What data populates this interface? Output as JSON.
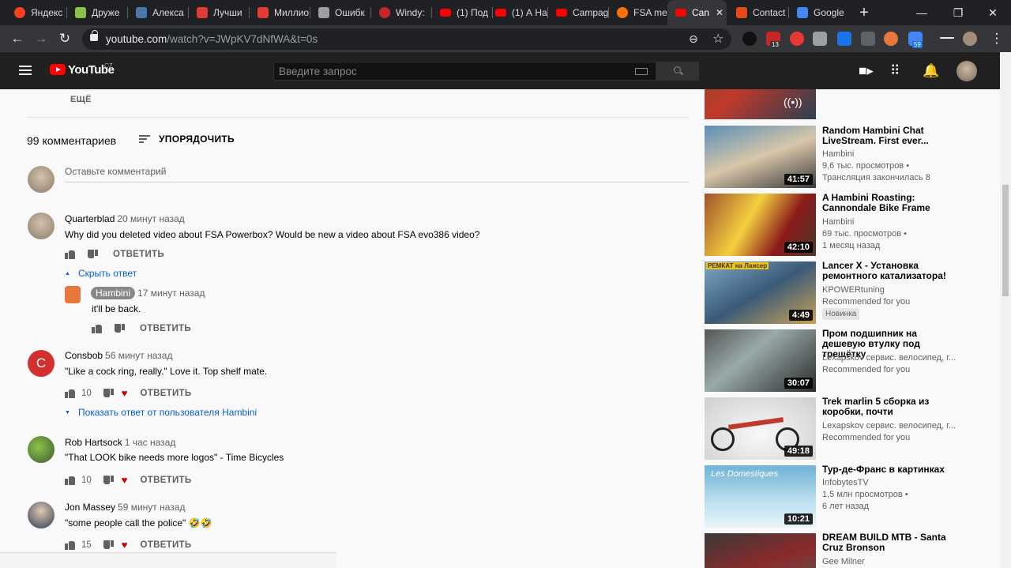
{
  "browser": {
    "tabs": [
      {
        "title": "Яндекс",
        "color": "#fc3f1d"
      },
      {
        "title": "Друже",
        "color": "#8bc34a"
      },
      {
        "title": "Алекса",
        "color": "#4a76a8"
      },
      {
        "title": "Лучши",
        "color": "#e53935"
      },
      {
        "title": "Миллио",
        "color": "#e53935"
      },
      {
        "title": "Ошибк",
        "color": "#9e9e9e"
      },
      {
        "title": "Windy:",
        "color": "#c62828"
      },
      {
        "title": "(1) Под",
        "color": "#ff0000"
      },
      {
        "title": "(1) А На",
        "color": "#ff0000"
      },
      {
        "title": "Campag",
        "color": "#ff0000"
      },
      {
        "title": "FSA me",
        "color": "#ff6f00"
      },
      {
        "title": "Can",
        "color": "#ff0000",
        "active": true
      },
      {
        "title": "Contact",
        "color": "#e64a19"
      },
      {
        "title": "Google",
        "color": "#4285f4"
      }
    ],
    "url_host": "youtube.com",
    "url_path": "/watch?v=JWpKV7dNfWA&t=0s",
    "ext_badges": [
      "13",
      "59"
    ]
  },
  "youtube": {
    "logo_text": "YouTube",
    "region": "CZ",
    "search_placeholder": "Введите запрос"
  },
  "comments_section": {
    "more_label": "ЕЩЁ",
    "count_label": "99 комментариев",
    "sort_label": "УПОРЯДОЧИТЬ",
    "add_comment_placeholder": "Оставьте комментарий",
    "reply_label": "ОТВЕТИТЬ",
    "comments": [
      {
        "author": "Quarterblad",
        "time": "20 минут назад",
        "text": "Why did you deleted video about FSA Powerbox? Would be new a video about FSA evo386 video?",
        "likes": "",
        "replies_toggle": "Скрыть ответ",
        "reply": {
          "author": "Hambini",
          "time": "17 минут назад",
          "text": "it'll be back."
        }
      },
      {
        "author": "Consbob",
        "time": "56 минут назад",
        "text": "\"Like a cock ring, really.\" Love it. Top shelf mate.",
        "likes": "10",
        "avatar_letter": "C",
        "replies_toggle": "Показать ответ от пользователя Hambini"
      },
      {
        "author": "Rob Hartsock",
        "time": "1 час назад",
        "text": "\"That LOOK bike needs more logos\" - Time Bicycles",
        "likes": "10"
      },
      {
        "author": "Jon Massey",
        "time": "59 минут назад",
        "text": "\"some people call the police\" 🤣🤣",
        "likes": "15"
      }
    ]
  },
  "sidebar": {
    "videos": [
      {
        "title": "",
        "meta": [],
        "duration": ""
      },
      {
        "title": "Random Hambini Chat LiveStream. First ever...",
        "meta": [
          "Hambini",
          "9,6 тыс. просмотров •",
          "Трансляция закончилась 8"
        ],
        "duration": "41:57"
      },
      {
        "title": "A Hambini Roasting: Cannondale Bike Frame",
        "meta": [
          "Hambini",
          "69 тыс. просмотров •",
          "1 месяц назад"
        ],
        "duration": "42:10"
      },
      {
        "title": "Lancer X - Установка ремонтного катализатора!",
        "meta": [
          "KPOWERtuning",
          "Recommended for you"
        ],
        "badge": "Новинка",
        "duration": "4:49",
        "thumb_text": "РЕМКАТ на Лансер"
      },
      {
        "title": "Пром подшипник на дешевую втулку под трещётку",
        "meta": [
          "Lexapskov сервис. велосипед, г...",
          "Recommended for you"
        ],
        "duration": "30:07"
      },
      {
        "title": "Trek marlin 5 сборка из коробки, почти",
        "meta": [
          "Lexapskov сервис. велосипед, г...",
          "Recommended for you"
        ],
        "duration": "49:18"
      },
      {
        "title": "Тур-де-Франс в картинках",
        "meta": [
          "InfobytesTV",
          "1,5 млн просмотров •",
          "6 лет назад"
        ],
        "duration": "10:21",
        "thumb_text": "Les Domestiques"
      },
      {
        "title": "DREAM BUILD MTB - Santa Cruz Bronson",
        "meta": [
          "Gee Milner"
        ],
        "duration": ""
      }
    ]
  }
}
